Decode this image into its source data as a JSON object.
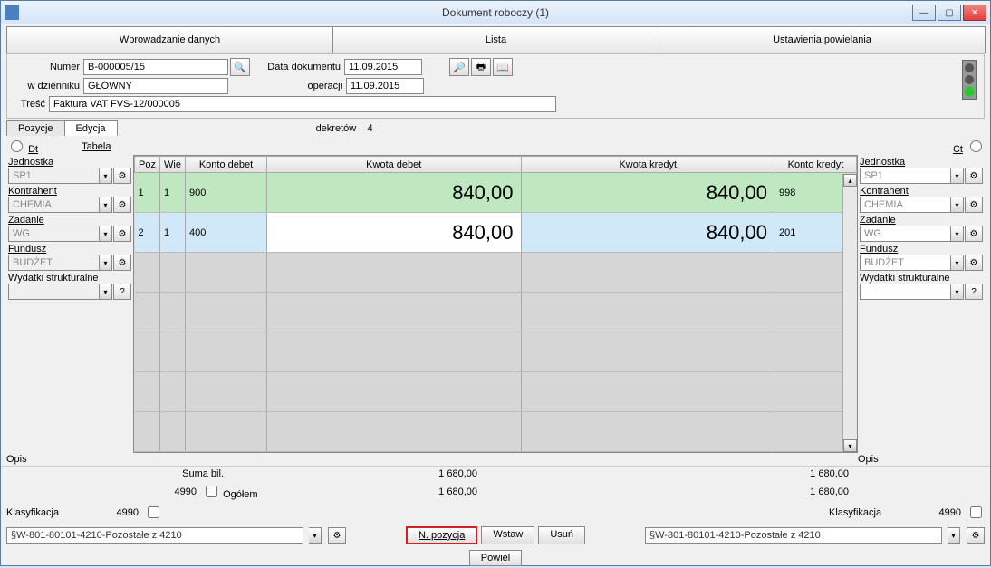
{
  "titlebar": {
    "title": "Dokument roboczy (1)"
  },
  "maintabs": {
    "t1": "Wprowadzanie danych",
    "t2": "Lista",
    "t3": "Ustawienia powielania"
  },
  "form": {
    "numer_lbl": "Numer",
    "numer_val": "B-000005/15",
    "wdzien_lbl": "w dzienniku",
    "wdzien_val": "GŁÓWNY",
    "datadok_lbl": "Data dokumentu",
    "datadok_val": "11.09.2015",
    "operacji_lbl": "operacji",
    "operacji_val": "11.09.2015",
    "tresc_lbl": "Treść",
    "tresc_val": "Faktura VAT FVS-12/000005"
  },
  "subtabs": {
    "pozycje": "Pozycje",
    "edycja": "Edycja",
    "dekretow_lbl": "dekretów",
    "dekretow_val": "4"
  },
  "radios": {
    "dt": "Dt",
    "tabela": "Tabela",
    "ct": "Ct"
  },
  "left": {
    "jednostka_lbl": "Jednostka",
    "jednostka_val": "SP1",
    "kontrahent_lbl": "Kontrahent",
    "kontrahent_val": "CHEMIA",
    "zadanie_lbl": "Zadanie",
    "zadanie_val": "WG",
    "fundusz_lbl": "Fundusz",
    "fundusz_val": "BUDŻET",
    "wydatki_lbl": "Wydatki strukturalne",
    "wydatki_val": ""
  },
  "right": {
    "jednostka_lbl": "Jednostka",
    "jednostka_val": "SP1",
    "kontrahent_lbl": "Kontrahent",
    "kontrahent_val": "CHEMIA",
    "zadanie_lbl": "Zadanie",
    "zadanie_val": "WG",
    "fundusz_lbl": "Fundusz",
    "fundusz_val": "BUDŻET",
    "wydatki_lbl": "Wydatki strukturalne",
    "wydatki_val": ""
  },
  "grid": {
    "hdr": {
      "poz": "Poz",
      "wie": "Wie",
      "kdeb": "Konto debet",
      "kwdeb": "Kwota debet",
      "kwkred": "Kwota kredyt",
      "kkred": "Konto kredyt"
    },
    "rows": [
      {
        "poz": "1",
        "wie": "1",
        "kdeb": "900",
        "kwdeb": "840,00",
        "kwkred": "840,00",
        "kkred": "998"
      },
      {
        "poz": "2",
        "wie": "1",
        "kdeb": "400",
        "kwdeb": "840,00",
        "kwkred": "840,00",
        "kkred": "201"
      }
    ]
  },
  "opis": {
    "label": "Opis"
  },
  "sums": {
    "sumabil_lbl": "Suma bil.",
    "sumabil_deb": "1 680,00",
    "sumabil_kred": "1 680,00",
    "ogolem_lbl": "Ogółem",
    "ogolem_num": "4990",
    "ogolem_deb": "1 680,00",
    "ogolem_kred": "1 680,00"
  },
  "klas": {
    "label_l": "Klasyfikacja",
    "num_l": "4990",
    "combo_l": "§W-801-80101-4210-Pozostałe z 4210",
    "label_r": "Klasyfikacja",
    "num_r": "4990",
    "combo_r": "§W-801-80101-4210-Pozostałe z 4210"
  },
  "buttons": {
    "npoz": "N. pozycja",
    "wstaw": "Wstaw",
    "usun": "Usuń",
    "powiel": "Powiel"
  }
}
